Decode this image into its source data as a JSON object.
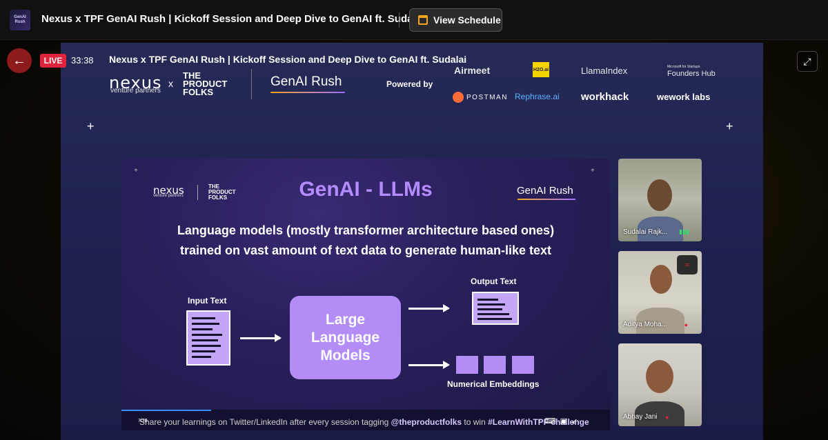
{
  "header": {
    "event_thumb_text": "GenAI Rush",
    "title": "Nexus x TPF GenAI Rush | Kickoff Session and Deep Dive to GenAI ft. Sudalai",
    "schedule_button": "View Schedule"
  },
  "stream": {
    "live_label": "LIVE",
    "elapsed": "33:38",
    "title": "Nexus x TPF GenAI Rush | Kickoff Session and Deep Dive to GenAI ft. Sudalai",
    "back_icon": "arrow-left-icon",
    "expand_icon": "fullscreen-icon"
  },
  "banner": {
    "nexus": "nexus",
    "nexus_sub": "venture partners",
    "x": "x",
    "tpf": "THE PRODUCT FOLKS",
    "genai_rush": "GenAI Rush",
    "powered_by": "Powered by",
    "sponsors": {
      "airmeet": "Airmeet",
      "h2o": "H2O.ai",
      "llamaindex": "LlamaIndex",
      "founders_hub_small": "Microsoft for Startups",
      "founders_hub": "Founders Hub",
      "postman": "POSTMAN",
      "rephrase": "Rephrase.ai",
      "workhack": "workhack",
      "wework": "wework labs"
    }
  },
  "slide": {
    "nexus": "nexus",
    "nexus_sub": "venture partners",
    "tpf": "THE PRODUCT FOLKS",
    "title": "GenAI - LLMs",
    "genai_rush": "GenAI Rush",
    "description_line1": "Language models (mostly transformer architecture based ones)",
    "description_line2": "trained on vast amount of text data to generate human-like text",
    "input_label": "Input Text",
    "llm_label": "Large Language Models",
    "output_label": "Output Text",
    "embeddings_label": "Numerical Embeddings"
  },
  "slide_bar": {
    "page": "7/38",
    "ticker_prefix": "Share your learnings on Twitter/LinkedIn after every session tagging",
    "ticker_handle": "@theproductfolks",
    "ticker_mid": "to win",
    "ticker_tag": "#LearnWithTPF challenge"
  },
  "participants": [
    {
      "name": "Sudalai Rajk...",
      "status_icon": "audio-level-icon"
    },
    {
      "name": "Aditya Moha...",
      "status_icon": "mic-muted-icon",
      "badge_icon": "no-connection-icon"
    },
    {
      "name": "Abhay Jani",
      "status_icon": "mic-muted-icon"
    }
  ],
  "colors": {
    "live_red": "#e0243b",
    "accent_purple": "#b48cff",
    "schedule_icon": "#f5a623"
  }
}
